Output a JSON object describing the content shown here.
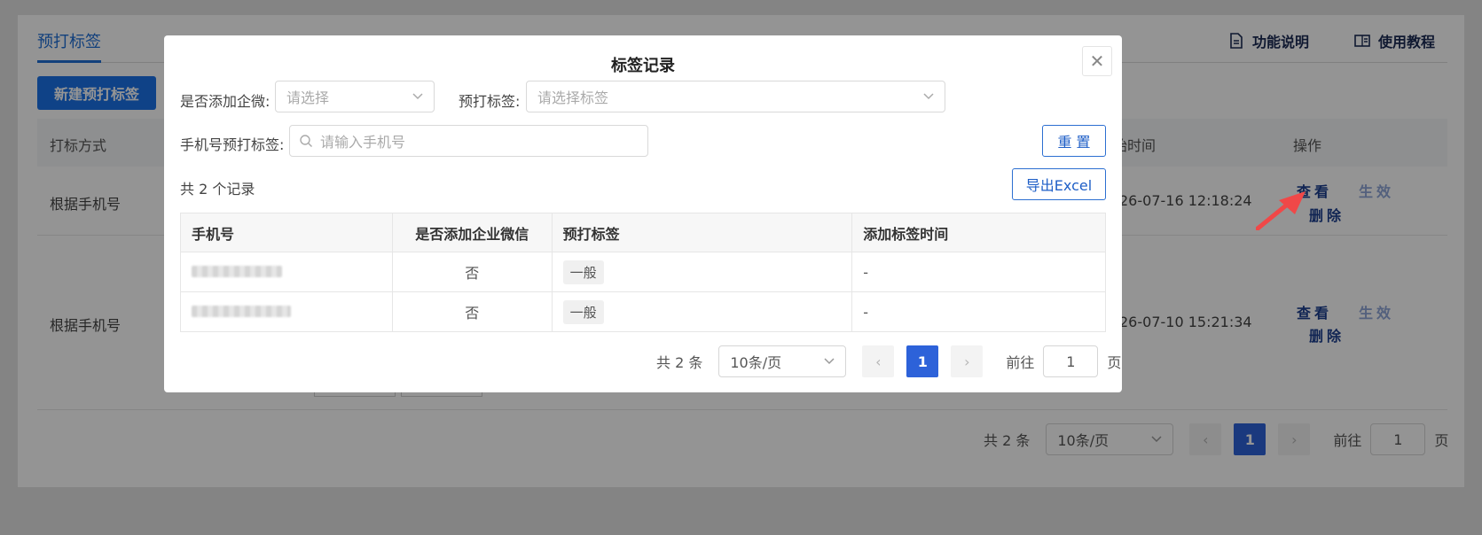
{
  "background": {
    "tab_label": "预打标签",
    "help_links": [
      "功能说明",
      "使用教程"
    ],
    "new_button": "新建预打标签",
    "columns": {
      "method": "打标方式",
      "time": "始时间",
      "actions": "操作"
    },
    "rows": [
      {
        "method": "根据手机号",
        "time": "26-07-16 12:18:24",
        "view": "查看",
        "enable": "生效",
        "delete": "删除"
      },
      {
        "method": "根据手机号",
        "time": "26-07-10 15:21:34",
        "view": "查看",
        "enable": "生效",
        "delete": "删除"
      }
    ],
    "pager": {
      "total": "共 2 条",
      "page_size": "10条/页",
      "current": "1",
      "goto_label": "前往",
      "goto_value": "1",
      "unit": "页"
    }
  },
  "dialog": {
    "title": "标签记录",
    "filters": {
      "wecom_label": "是否添加企微:",
      "wecom_placeholder": "请选择",
      "tag_label": "预打标签:",
      "tag_placeholder": "请选择标签",
      "phone_label": "手机号预打标签:",
      "phone_placeholder": "请输入手机号"
    },
    "reset_button": "重 置",
    "export_button": "导出Excel",
    "record_count": "共 2 个记录",
    "table": {
      "headers": [
        "手机号",
        "是否添加企业微信",
        "预打标签",
        "添加标签时间"
      ],
      "rows": [
        {
          "added": "否",
          "tag": "一般",
          "time": "-"
        },
        {
          "added": "否",
          "tag": "一般",
          "time": "-"
        }
      ]
    },
    "pager": {
      "total": "共 2 条",
      "page_size": "10条/页",
      "current": "1",
      "goto_label": "前往",
      "goto_value": "1",
      "unit": "页"
    }
  }
}
